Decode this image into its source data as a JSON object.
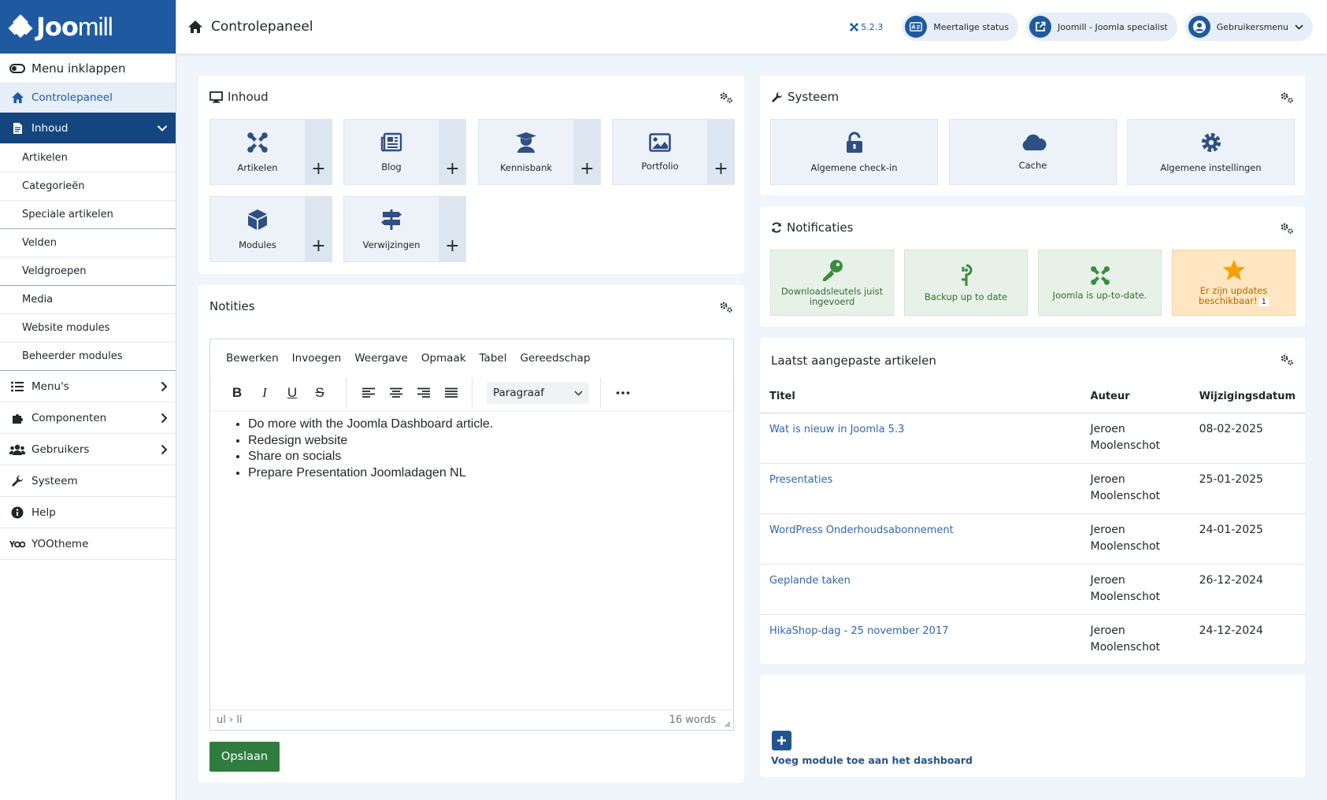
{
  "brand": {
    "logo_text_bold": "Joo",
    "logo_text_light": "mill",
    "color": "#1f5aa0"
  },
  "sidebar": {
    "collapse_label": "Menu inklappen",
    "dashboard_label": "Controlepaneel",
    "content_label": "Inhoud",
    "content_items": [
      "Artikelen",
      "Categorieën",
      "Speciale artikelen",
      "Velden",
      "Veldgroepen",
      "Media",
      "Website modules",
      "Beheerder modules"
    ],
    "menus_label": "Menu's",
    "components_label": "Componenten",
    "users_label": "Gebruikers",
    "system_label": "Systeem",
    "help_label": "Help",
    "yootheme_label": "YOOtheme"
  },
  "header": {
    "title": "Controlepaneel",
    "version": "5.2.3",
    "multilang_label": "Meertalige status",
    "site_label": "Joomill - Joomla specialist",
    "user_menu_label": "Gebruikersmenu"
  },
  "content_module": {
    "title": "Inhoud",
    "tiles": [
      "Artikelen",
      "Blog",
      "Kennisbank",
      "Portfolio",
      "Modules",
      "Verwijzingen"
    ]
  },
  "system_module": {
    "title": "Systeem",
    "tiles": [
      "Algemene check-in",
      "Cache",
      "Algemene instellingen"
    ]
  },
  "notifications": {
    "title": "Notificaties",
    "items": [
      "Downloadsleutels juist ingevoerd",
      "Backup up to date",
      "Joomla is up-to-date.",
      "Er zijn updates beschikbaar!"
    ],
    "updates_count": "1"
  },
  "notes": {
    "title": "Notities",
    "menu": [
      "Bewerken",
      "Invoegen",
      "Weergave",
      "Opmaak",
      "Tabel",
      "Gereedschap"
    ],
    "block_format": "Paragraaf",
    "items": [
      "Do more with the Joomla Dashboard article.",
      "Redesign website",
      "Share on socials",
      "Prepare Presentation Joomladagen NL"
    ],
    "path": "ul › li",
    "word_count": "16 words",
    "save_label": "Opslaan"
  },
  "recent_articles": {
    "title": "Laatst aangepaste artikelen",
    "columns": [
      "Titel",
      "Auteur",
      "Wijzigingsdatum"
    ],
    "rows": [
      {
        "title": "Wat is nieuw in Joomla 5.3",
        "author": "Jeroen Moolenschot",
        "date": "08-02-2025"
      },
      {
        "title": "Presentaties",
        "author": "Jeroen Moolenschot",
        "date": "25-01-2025"
      },
      {
        "title": "WordPress Onderhoudsabonnement",
        "author": "Jeroen Moolenschot",
        "date": "24-01-2025"
      },
      {
        "title": "Geplande taken",
        "author": "Jeroen Moolenschot",
        "date": "26-12-2024"
      },
      {
        "title": "HikaShop-dag - 25 november 2017",
        "author": "Jeroen Moolenschot",
        "date": "24-12-2024"
      }
    ]
  },
  "add_module_label": "Voeg module toe aan het dashboard"
}
